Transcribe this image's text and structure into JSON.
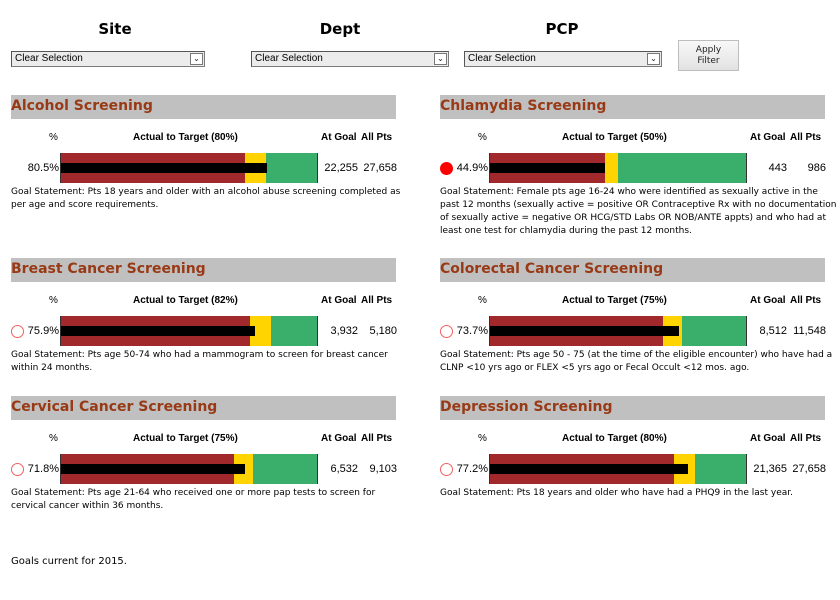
{
  "filters": {
    "site": {
      "label": "Site",
      "value": "Clear Selection"
    },
    "dept": {
      "label": "Dept",
      "value": "Clear Selection"
    },
    "pcp": {
      "label": "PCP",
      "value": "Clear Selection"
    },
    "apply_label_line1": "Apply",
    "apply_label_line2": "Filter"
  },
  "column_headers": {
    "pct": "%",
    "at_goal": "At Goal",
    "all_pts": "All Pts"
  },
  "colors": {
    "below": "#a1282b",
    "near": "#ffd400",
    "goal": "#3aaf6c",
    "title": "#983a16",
    "status_red": "#ff0000"
  },
  "panels": [
    {
      "title": "Alcohol Screening",
      "target_label": "Actual to Target (80%)",
      "target": 80,
      "actual": 80.5,
      "pct_label": "80.5%",
      "status": "none",
      "at_goal": "22,255",
      "all_pts": "27,658",
      "goal_statement": "Goal Statement: Pts 18 years and older with an alcohol abuse screening completed as per age and score requirements."
    },
    {
      "title": "Chlamydia Screening",
      "target_label": "Actual to Target (50%)",
      "target": 50,
      "actual": 44.9,
      "pct_label": "44.9%",
      "status": "red-filled",
      "at_goal": "443",
      "all_pts": "986",
      "goal_statement": "Goal Statement: Female pts age 16-24 who were identified as sexually active in the past 12 months (sexually active = positive OR Contraceptive Rx with no documentation of sexually active = negative OR HCG/STD Labs OR NOB/ANTE appts) and who had at least one test for chlamydia during the past 12 months."
    },
    {
      "title": "Breast Cancer Screening",
      "target_label": "Actual to Target (82%)",
      "target": 82,
      "actual": 75.9,
      "pct_label": "75.9%",
      "status": "red-hollow",
      "at_goal": "3,932",
      "all_pts": "5,180",
      "goal_statement": "Goal Statement: Pts age 50-74 who had a mammogram to screen for breast cancer within 24 months."
    },
    {
      "title": "Colorectal Cancer Screening",
      "target_label": "Actual to Target (75%)",
      "target": 75,
      "actual": 73.7,
      "pct_label": "73.7%",
      "status": "red-hollow",
      "at_goal": "8,512",
      "all_pts": "11,548",
      "goal_statement": "Goal Statement: Pts age 50 - 75 (at the time of the eligible encounter) who have had a CLNP <10 yrs ago or FLEX <5 yrs ago or Fecal Occult <12 mos. ago."
    },
    {
      "title": "Cervical Cancer Screening",
      "target_label": "Actual to Target (75%)",
      "target": 75,
      "actual": 71.8,
      "pct_label": "71.8%",
      "status": "red-hollow",
      "at_goal": "6,532",
      "all_pts": "9,103",
      "goal_statement": "Goal Statement: Pts age 21-64 who received one or more pap tests to screen for cervical cancer within 36 months."
    },
    {
      "title": "Depression Screening",
      "target_label": "Actual to Target (80%)",
      "target": 80,
      "actual": 77.2,
      "pct_label": "77.2%",
      "status": "red-hollow",
      "at_goal": "21,365",
      "all_pts": "27,658",
      "goal_statement": "Goal Statement: Pts 18 years and older who have had a PHQ9 in the last year."
    }
  ],
  "chart_data": {
    "type": "bar",
    "subtype": "bullet",
    "categories": [
      "Alcohol Screening",
      "Chlamydia Screening",
      "Breast Cancer Screening",
      "Colorectal Cancer Screening",
      "Cervical Cancer Screening",
      "Depression Screening"
    ],
    "series": [
      {
        "name": "Actual %",
        "values": [
          80.5,
          44.9,
          75.9,
          73.7,
          71.8,
          77.2
        ]
      },
      {
        "name": "Target %",
        "values": [
          80,
          50,
          82,
          75,
          75,
          80
        ]
      }
    ],
    "ylim": [
      0,
      100
    ],
    "bands": [
      "below (red) up to 90% of target",
      "near (yellow) up to target",
      "at goal (green) to 100"
    ]
  },
  "footer": "Goals current for 2015."
}
